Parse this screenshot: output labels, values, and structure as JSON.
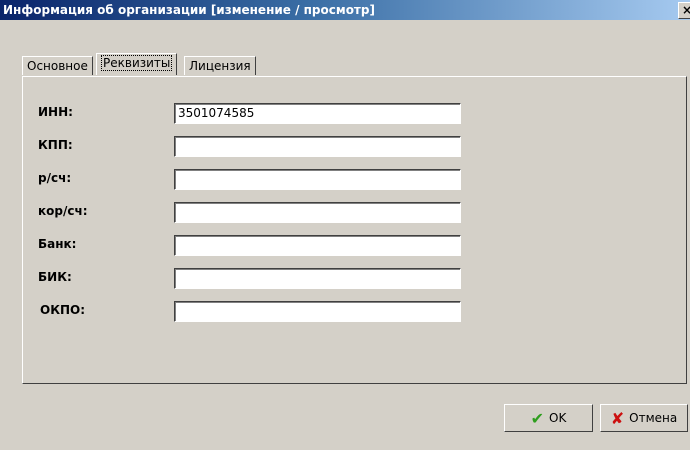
{
  "window": {
    "title": "Информация об организации [изменение / просмотр]",
    "close_label": "×"
  },
  "tabs": [
    {
      "label": "Основное"
    },
    {
      "label": "Реквизиты",
      "active": true
    },
    {
      "label": "Лицензия"
    }
  ],
  "fields": [
    {
      "label": "ИНН:",
      "value": "3501074585"
    },
    {
      "label": "КПП:",
      "value": ""
    },
    {
      "label": "р/сч:",
      "value": ""
    },
    {
      "label": "кор/сч:",
      "value": ""
    },
    {
      "label": "Банк:",
      "value": ""
    },
    {
      "label": "БИК:",
      "value": ""
    },
    {
      "label": "ОКПО:",
      "value": ""
    }
  ],
  "buttons": {
    "ok_label": "OK",
    "ok_icon": "checkmark-icon",
    "ok_icon_color": "#2e9e1e",
    "cancel_label": "Отмена",
    "cancel_icon": "red-x-icon",
    "cancel_icon_color": "#cc1010"
  }
}
